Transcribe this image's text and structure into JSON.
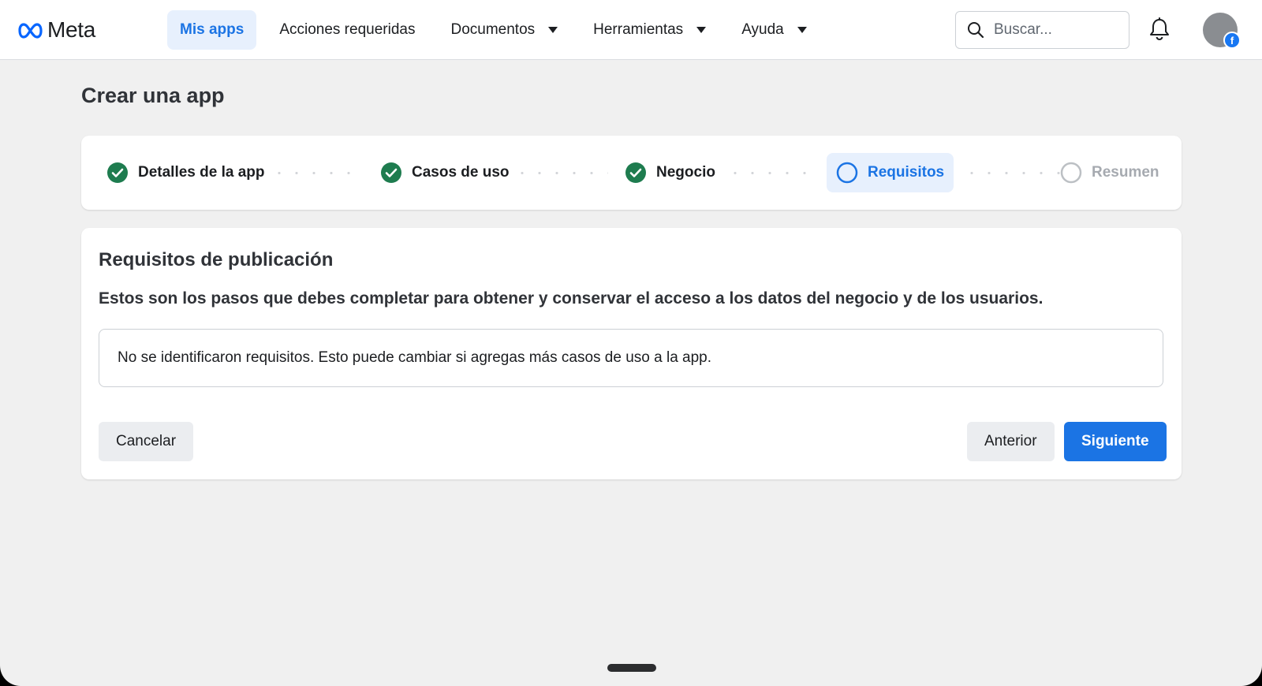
{
  "brand": {
    "name": "Meta",
    "accent": "#1b74e4"
  },
  "nav": {
    "items": [
      {
        "label": "Mis apps",
        "active": true,
        "dropdown": false
      },
      {
        "label": "Acciones requeridas",
        "active": false,
        "dropdown": false
      },
      {
        "label": "Documentos",
        "active": false,
        "dropdown": true
      },
      {
        "label": "Herramientas",
        "active": false,
        "dropdown": true
      },
      {
        "label": "Ayuda",
        "active": false,
        "dropdown": true
      }
    ]
  },
  "search": {
    "placeholder": "Buscar...",
    "icon": "search-icon"
  },
  "header_icons": {
    "notifications": "bell-icon",
    "avatar_badge": "f"
  },
  "page": {
    "title": "Crear una app"
  },
  "stepper": {
    "steps": [
      {
        "label": "Detalles de la app",
        "state": "done"
      },
      {
        "label": "Casos de uso",
        "state": "done"
      },
      {
        "label": "Negocio",
        "state": "done"
      },
      {
        "label": "Requisitos",
        "state": "current"
      },
      {
        "label": "Resumen",
        "state": "pending"
      }
    ],
    "colors": {
      "done": "#1e7c4f",
      "current": "#1b74e4",
      "pending": "#bcc0c4"
    }
  },
  "card": {
    "title": "Requisitos de publicación",
    "description": "Estos son los pasos que debes completar para obtener y conservar el acceso a los datos del negocio y de los usuarios.",
    "notice": "No se identificaron requisitos. Esto puede cambiar si agregas más casos de uso a la app."
  },
  "buttons": {
    "cancel": "Cancelar",
    "previous": "Anterior",
    "next": "Siguiente"
  }
}
